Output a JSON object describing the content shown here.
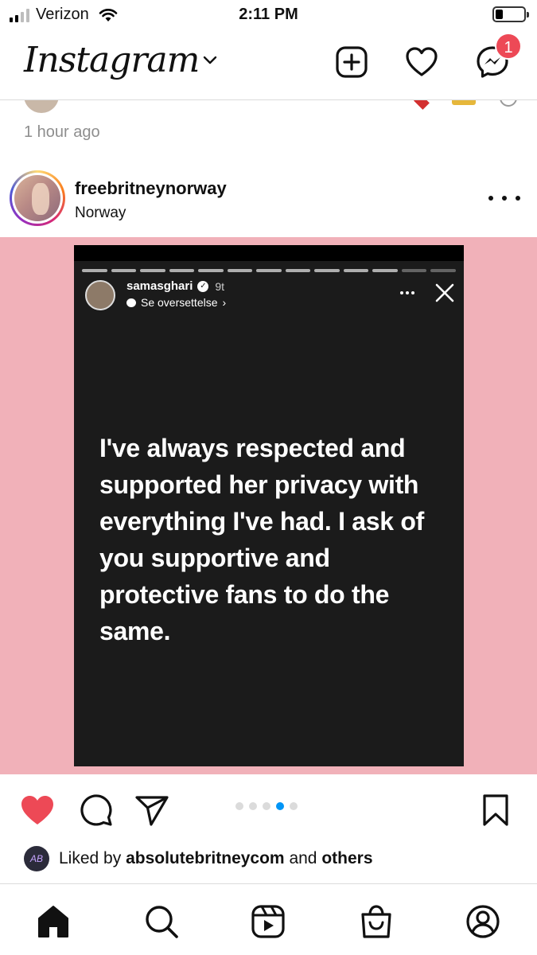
{
  "status_bar": {
    "carrier": "Verizon",
    "time": "2:11 PM",
    "signal_bars_active": 2,
    "battery_level": 0.2
  },
  "header": {
    "logo_text": "Instagram",
    "messages_badge": "1",
    "icons": [
      "chevron-down-icon",
      "new-post-icon",
      "heart-icon",
      "messenger-icon"
    ]
  },
  "previous_post": {
    "time_ago": "1 hour ago"
  },
  "post": {
    "username": "freebritneynorway",
    "location": "Norway",
    "story": {
      "username": "samasghari",
      "age": "9t",
      "translate_label": "Se oversettelse",
      "translate_chevron": "›",
      "text": "I've always respected and supported her privacy with everything I've had. I ask of you supportive and protective fans to do the same."
    },
    "carousel": {
      "count": 5,
      "active_index": 3
    },
    "liked_by": {
      "prefix": "Liked by",
      "user": "absolutebritneycom",
      "connector": "and",
      "others": "others",
      "avatar_text": "AB"
    },
    "liked": true
  },
  "colors": {
    "like_red": "#ed4956",
    "badge_red": "#ed4956",
    "carousel_active": "#0095f6",
    "media_bg": "#f1b1b9",
    "story_bg": "#1b1b1b"
  },
  "bottom_nav": [
    "home-icon",
    "search-icon",
    "reels-icon",
    "shop-icon",
    "profile-icon"
  ]
}
